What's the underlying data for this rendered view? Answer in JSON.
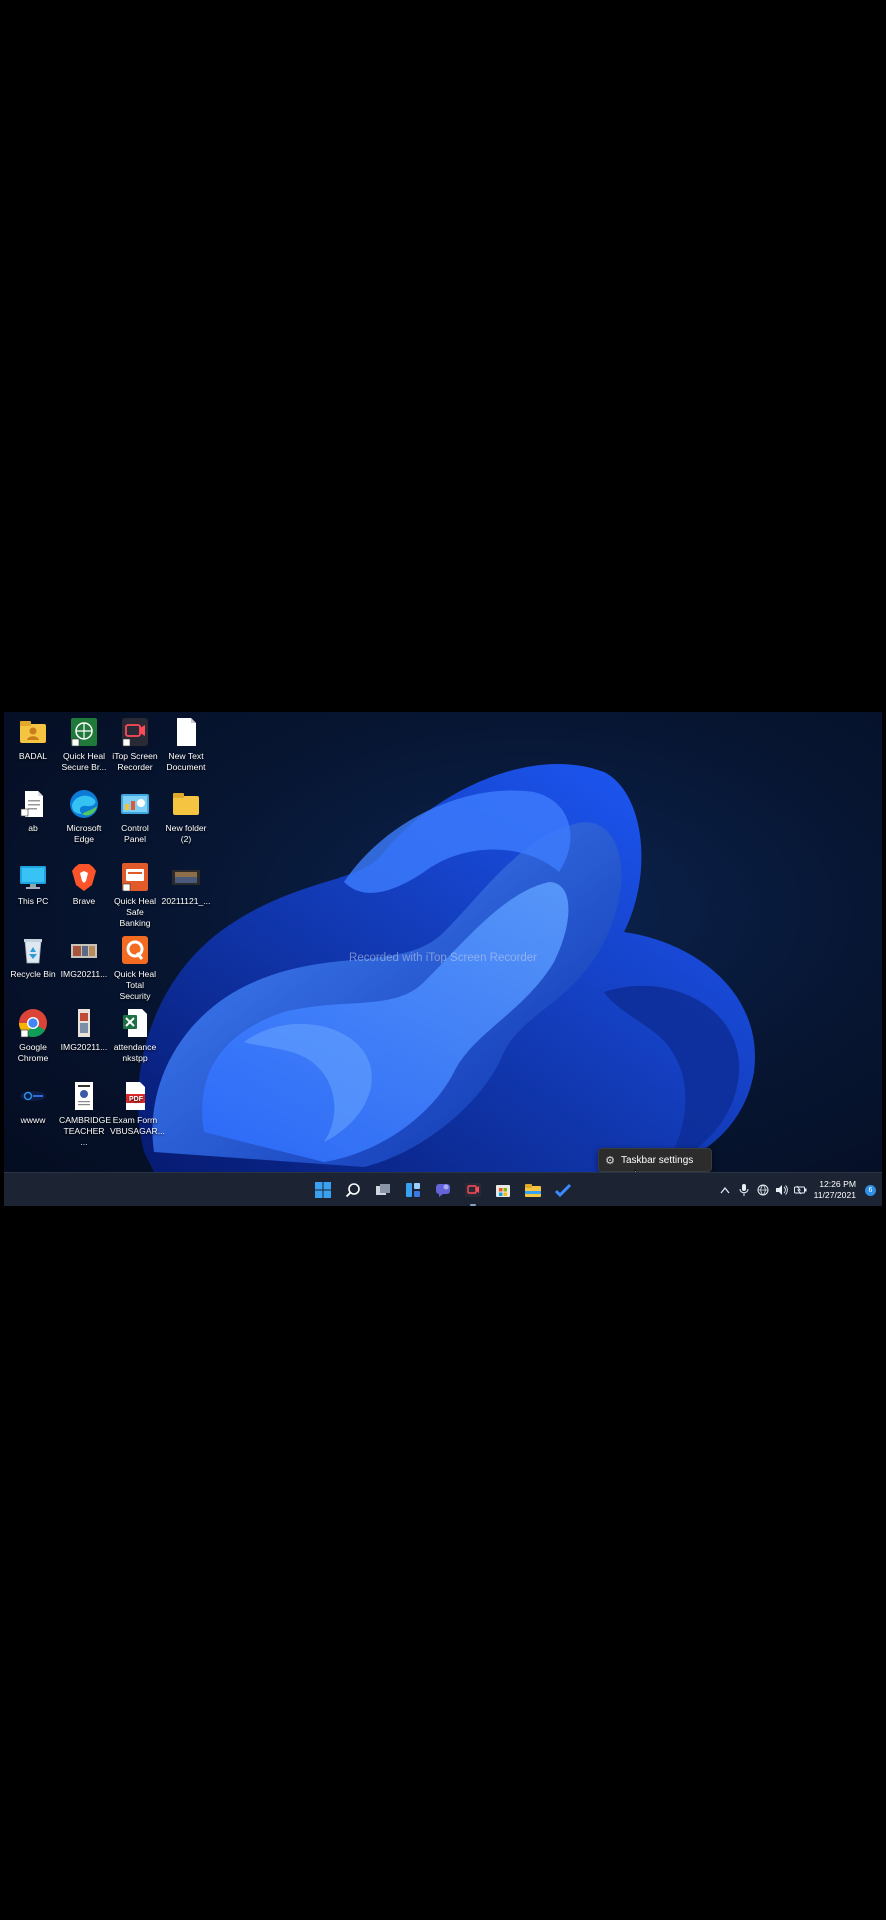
{
  "watermark": "Recorded with iTop Screen Recorder",
  "desktop_icons": [
    {
      "label": "BADAL",
      "icon": "user-folder-icon"
    },
    {
      "label": "Quick Heal Secure Br...",
      "icon": "quick-heal-browser-icon"
    },
    {
      "label": "iTop Screen Recorder",
      "icon": "itop-recorder-icon"
    },
    {
      "label": "New Text Document",
      "icon": "text-document-icon"
    },
    {
      "label": "ab",
      "icon": "document-icon"
    },
    {
      "label": "Microsoft Edge",
      "icon": "edge-icon"
    },
    {
      "label": "Control Panel",
      "icon": "control-panel-icon"
    },
    {
      "label": "New folder (2)",
      "icon": "folder-icon"
    },
    {
      "label": "This PC",
      "icon": "this-pc-icon"
    },
    {
      "label": "Brave",
      "icon": "brave-icon"
    },
    {
      "label": "Quick Heal Safe Banking",
      "icon": "safe-banking-icon"
    },
    {
      "label": "20211121_...",
      "icon": "video-icon"
    },
    {
      "label": "Recycle Bin",
      "icon": "recycle-bin-icon"
    },
    {
      "label": "IMG20211...",
      "icon": "image-icon"
    },
    {
      "label": "Quick Heal Total Security",
      "icon": "quick-heal-icon"
    },
    {
      "label": "Google Chrome",
      "icon": "chrome-icon"
    },
    {
      "label": "IMG20211...",
      "icon": "image-icon"
    },
    {
      "label": "attendance nkstpp",
      "icon": "excel-icon"
    },
    {
      "label": "wwww",
      "icon": "shortcut-icon"
    },
    {
      "label": "CAMBRIDGE TEACHER ...",
      "icon": "document-icon"
    },
    {
      "label": "Exam Form VBUSAGAR...",
      "icon": "pdf-icon"
    }
  ],
  "context_menu": {
    "item": "Taskbar settings",
    "icon": "gear-icon"
  },
  "taskbar": {
    "apps": [
      "start-icon",
      "search-icon",
      "task-view-icon",
      "widgets-icon",
      "chat-icon",
      "itop-recorder-icon",
      "store-icon",
      "file-explorer-icon",
      "todo-icon"
    ],
    "clock": {
      "time": "12:26 PM",
      "date": "11/27/2021"
    },
    "notifications": "6",
    "colors": {
      "taskbar": "#1c2433",
      "accent": "#2d8fe6"
    }
  }
}
